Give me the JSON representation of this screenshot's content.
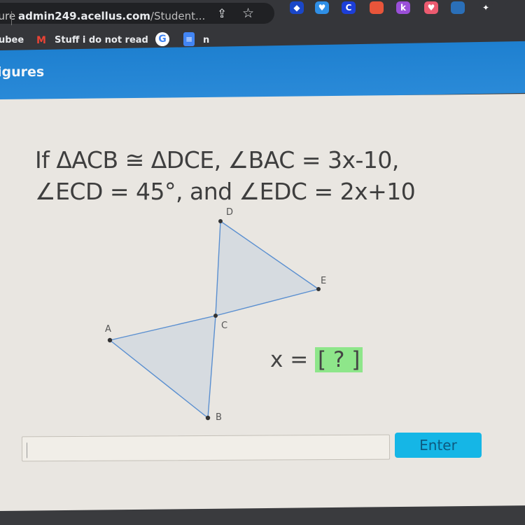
{
  "browser": {
    "security_label": "ecure",
    "url_domain": "admin249.acellus.com",
    "url_path": "/Student...",
    "share_icon": "share-icon",
    "star_icon": "bookmark-star-icon",
    "extensions": [
      {
        "name": "extension-diamond-icon",
        "glyph": "◆",
        "color": "#1a47c8"
      },
      {
        "name": "extension-heart-icon",
        "glyph": "♥",
        "color": "#2f8fe6"
      },
      {
        "name": "extension-c-icon",
        "glyph": "C",
        "color": "#1c3ed8"
      },
      {
        "name": "extension-red-icon",
        "glyph": "",
        "color": "#e8553a"
      },
      {
        "name": "extension-k-icon",
        "glyph": "k",
        "color": "#9a4fd8"
      },
      {
        "name": "extension-pink-icon",
        "glyph": "♥",
        "color": "#ec5b70"
      },
      {
        "name": "extension-blue-icon",
        "glyph": "",
        "color": "#2a6fb8"
      },
      {
        "name": "extensions-puzzle-icon",
        "glyph": "✦",
        "color": "#35363a"
      },
      {
        "name": "cast-icon",
        "glyph": "",
        "color": "#35363a"
      }
    ]
  },
  "bookmarks": {
    "items": [
      {
        "label": "ubee"
      },
      {
        "label": "Stuff i do not read"
      },
      {
        "label": "n"
      }
    ],
    "gmail_icon": "M",
    "google_icon": "G",
    "docs_icon": "≡"
  },
  "header": {
    "title": "igures"
  },
  "problem": {
    "line1": "If ΔACB ≅ ΔDCE, ∠BAC = 3x-10,",
    "line2": "∠ECD = 45°, and ∠EDC = 2x+10"
  },
  "figure": {
    "points": {
      "A": {
        "label": "A"
      },
      "B": {
        "label": "B"
      },
      "C": {
        "label": "C"
      },
      "D": {
        "label": "D"
      },
      "E": {
        "label": "E"
      }
    },
    "fill_color": "#d6dbe0",
    "stroke_color": "#5a8fd0"
  },
  "answer": {
    "prefix": "x = ",
    "placeholder": "[ ? ]"
  },
  "input": {
    "value": "",
    "placeholder": ""
  },
  "enter_button": {
    "label": "Enter"
  }
}
